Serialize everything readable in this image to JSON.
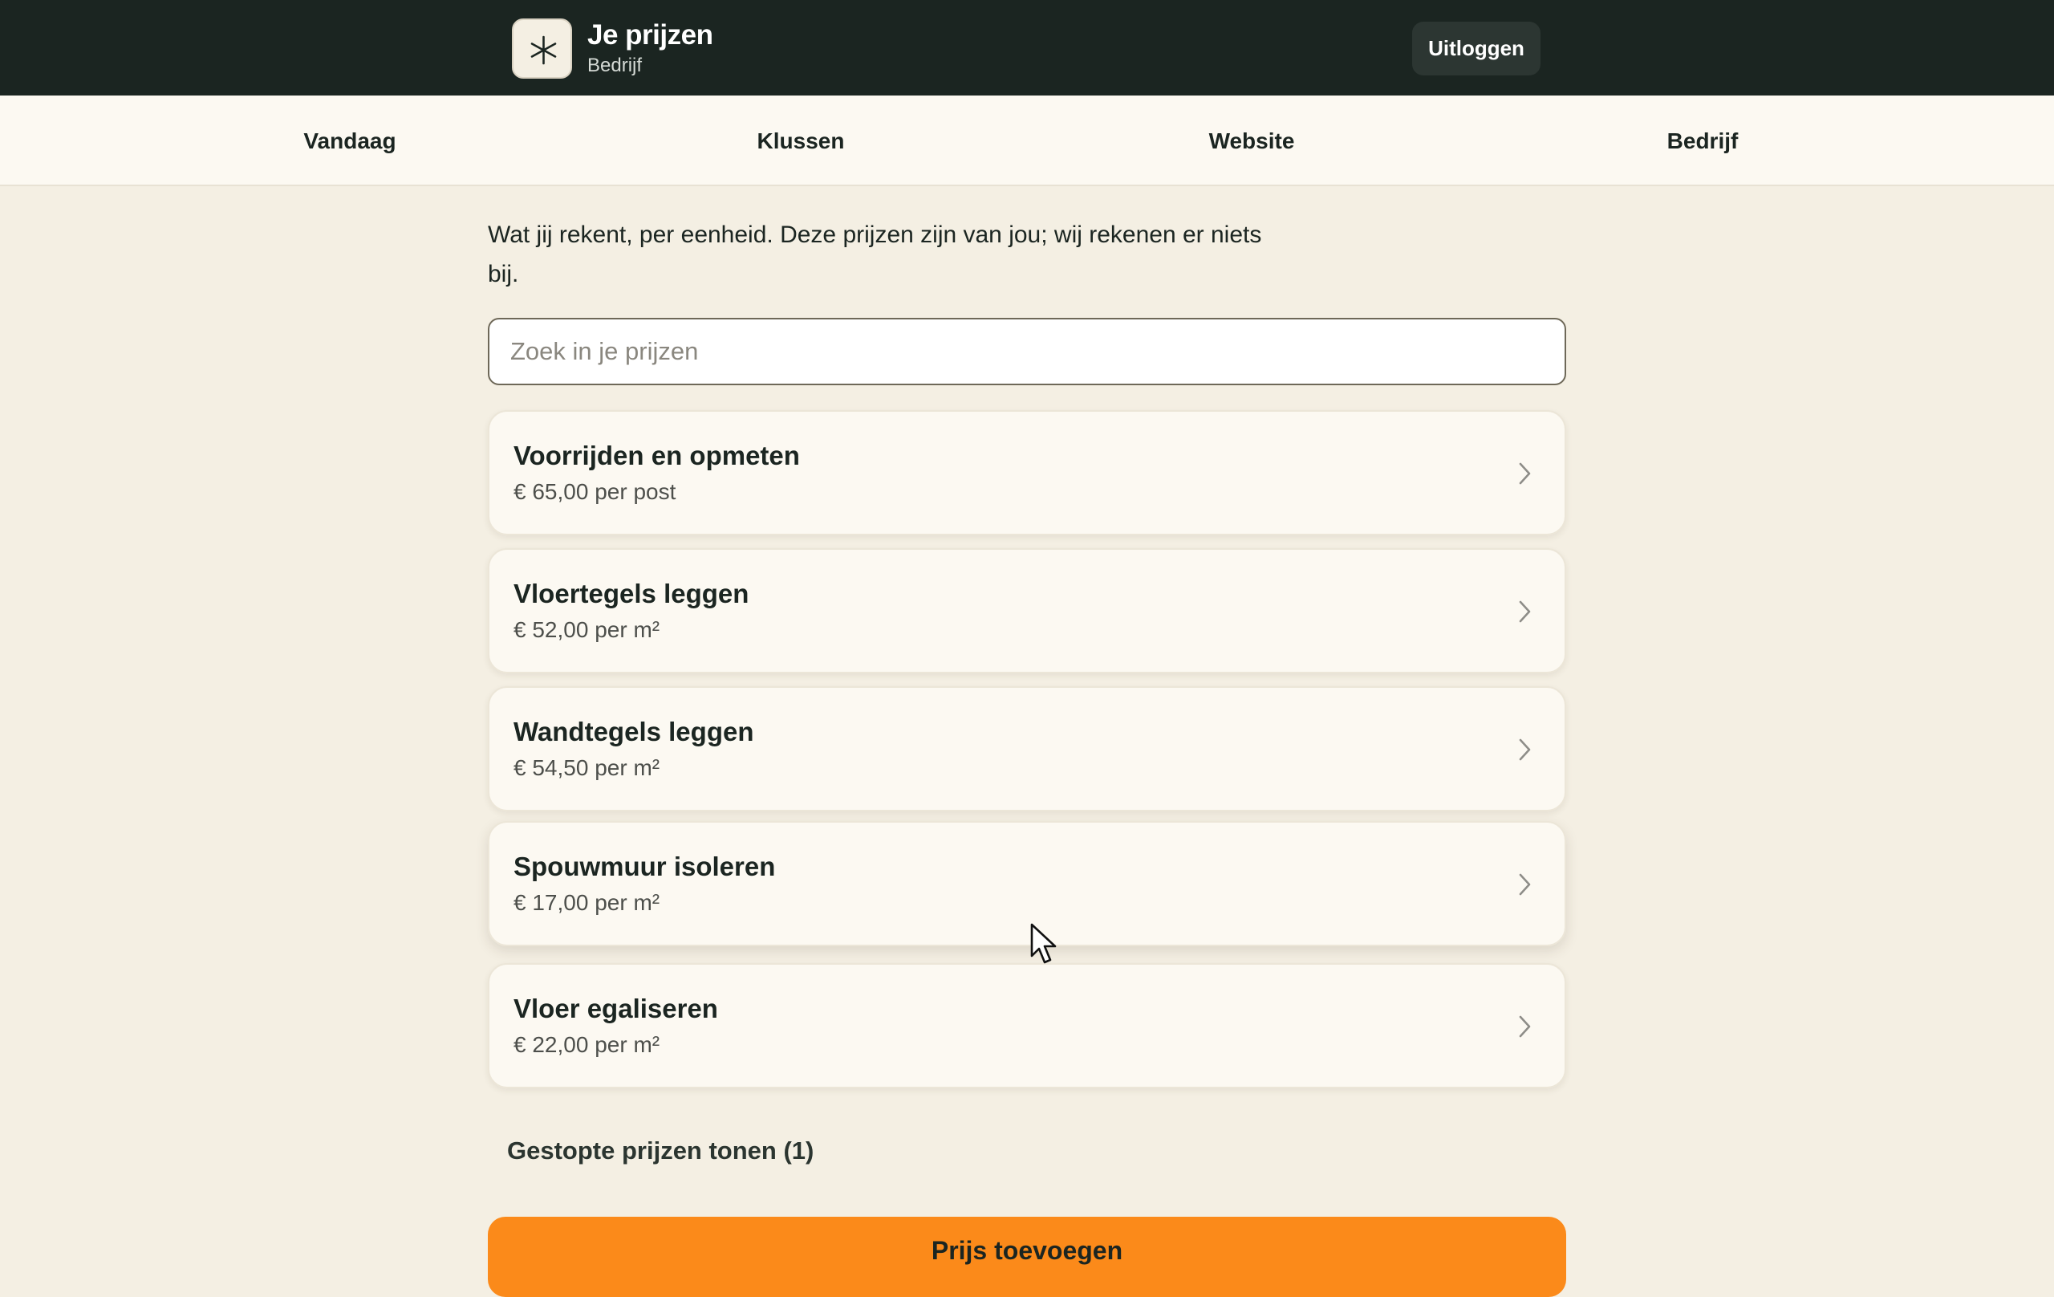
{
  "header": {
    "title": "Je prijzen",
    "subtitle": "Bedrijf",
    "logo_icon": "asterisk-icon",
    "logout_label": "Uitloggen"
  },
  "nav": {
    "items": [
      {
        "label": "Vandaag"
      },
      {
        "label": "Klussen"
      },
      {
        "label": "Website"
      },
      {
        "label": "Bedrijf"
      }
    ]
  },
  "main": {
    "intro": "Wat jij rekent, per eenheid. Deze prijzen zijn van jou; wij rekenen er niets bij.",
    "search_placeholder": "Zoek in je prijzen",
    "prices": [
      {
        "name": "Voorrijden en opmeten",
        "price": "€ 65,00 per post"
      },
      {
        "name": "Vloertegels leggen",
        "price": "€ 52,00 per m²"
      },
      {
        "name": "Wandtegels leggen",
        "price": "€ 54,50 per m²"
      },
      {
        "name": "Spouwmuur isoleren",
        "price": "€ 17,00 per m²"
      },
      {
        "name": "Vloer egaliseren",
        "price": "€ 22,00 per m²"
      }
    ],
    "stopped_link": "Gestopte prijzen tonen (1)",
    "add_button": "Prijs toevoegen"
  },
  "colors": {
    "header_bg": "#1b2521",
    "page_bg": "#f4efe3",
    "card_bg": "#fcf9f2",
    "accent": "#fb8a1a"
  }
}
